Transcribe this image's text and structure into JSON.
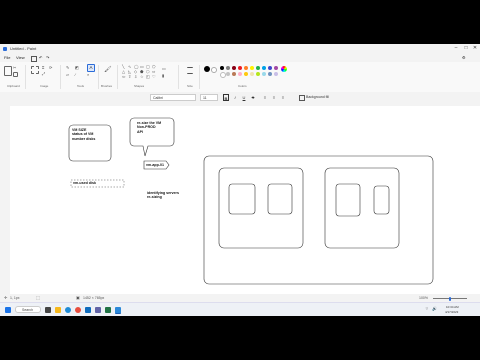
{
  "window": {
    "title": "Untitled - Paint",
    "minimize_glyph": "–",
    "maximize_glyph": "□",
    "close_glyph": "✕"
  },
  "menu": {
    "file": "File",
    "view": "View"
  },
  "ribbon": {
    "groups": {
      "clipboard": "Clipboard",
      "image": "Image",
      "tools": "Tools",
      "brushes": "Brushes",
      "shapes": "Shapes",
      "size": "Size",
      "colors": "Colors"
    },
    "colors": {
      "primary": "#000000",
      "secondary": "#ffffff",
      "row1": [
        "#000000",
        "#7f7f7f",
        "#880015",
        "#ed1c24",
        "#ff7f27",
        "#fff200",
        "#22b14c",
        "#00a2e8",
        "#3f48cc",
        "#a349a4"
      ],
      "row2": [
        "#ffffff",
        "#c3c3c3",
        "#b97a57",
        "#ffaec9",
        "#ffc90e",
        "#efe4b0",
        "#b5e61d",
        "#99d9ea",
        "#7092be",
        "#c8bfe7"
      ]
    }
  },
  "textbar": {
    "font": "Calibri",
    "size": "11",
    "bold": "B",
    "background_fill": "Background fill"
  },
  "canvas": {
    "notes": {
      "vm_size": [
        "VM SIZE",
        "status of VM",
        "number disks"
      ],
      "resize": [
        "re-size the VM",
        "Non-PROD",
        "API"
      ],
      "vm_app": "vm-app-01",
      "vm_used": "vm-used disk",
      "identifying": [
        "identifying servers",
        "re-sizing"
      ]
    }
  },
  "status": {
    "position": "1, 1px",
    "size": "1452 × 765px",
    "zoom": "100%"
  },
  "taskbar": {
    "search": "Search",
    "time": "10:34 AM",
    "date": "4/17/2023"
  }
}
